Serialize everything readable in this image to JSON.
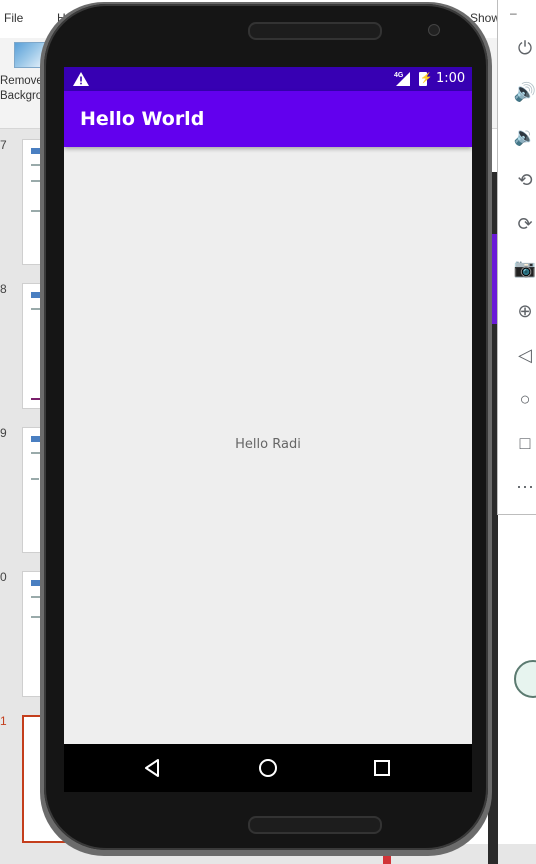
{
  "ppt": {
    "tabs": [
      {
        "label": "File"
      },
      {
        "label": "H"
      },
      {
        "label": "Show"
      }
    ],
    "remove_background_label": "Remove\nBackgrou",
    "slides": [
      {
        "number": "7"
      },
      {
        "number": "8"
      },
      {
        "number": "9"
      },
      {
        "number": "0"
      },
      {
        "number": "1"
      }
    ]
  },
  "emulator": {
    "minimize": "–",
    "buttons": [
      {
        "name": "power-icon",
        "glyph": "⏻"
      },
      {
        "name": "volume-up-icon",
        "glyph": "🔊"
      },
      {
        "name": "volume-down-icon",
        "glyph": "🔉"
      },
      {
        "name": "rotate-left-icon",
        "glyph": "⟲"
      },
      {
        "name": "rotate-right-icon",
        "glyph": "⟳"
      },
      {
        "name": "camera-icon",
        "glyph": "📷"
      },
      {
        "name": "zoom-icon",
        "glyph": "⊕"
      },
      {
        "name": "back-icon",
        "glyph": "◁"
      },
      {
        "name": "home-icon",
        "glyph": "○"
      },
      {
        "name": "overview-icon",
        "glyph": "□"
      },
      {
        "name": "more-icon",
        "glyph": "⋯"
      }
    ]
  },
  "phone": {
    "status": {
      "network": "4G",
      "time": "1:00"
    },
    "app_title": "Hello World",
    "content_text": "Hello Radi",
    "colors": {
      "status_bar": "#3700b3",
      "app_bar": "#6200ee",
      "screen_bg": "#eeeeee"
    }
  }
}
